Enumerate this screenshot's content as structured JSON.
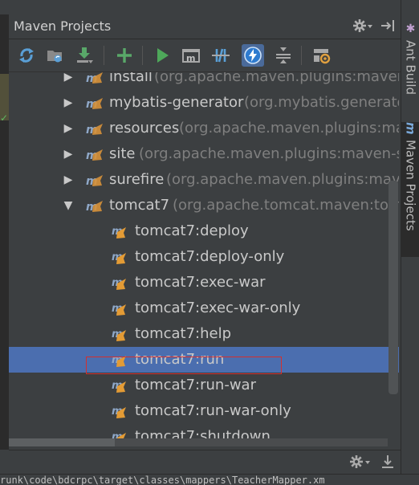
{
  "window": {
    "title": "Maven Projects"
  },
  "title_icons": [
    "gear-dropdown-icon",
    "hide-panel-icon"
  ],
  "toolbar": {
    "buttons": [
      {
        "name": "reimport-icon"
      },
      {
        "name": "generate-sources-icon"
      },
      {
        "name": "download-icon"
      },
      {
        "name": "add-icon"
      },
      {
        "name": "run-icon"
      },
      {
        "name": "execute-goal-icon"
      },
      {
        "name": "toggle-offline-icon"
      },
      {
        "name": "skip-tests-icon"
      },
      {
        "name": "collapse-all-icon"
      },
      {
        "name": "settings-icon"
      }
    ]
  },
  "tree": {
    "plugins": [
      {
        "name": "install",
        "detail": "(org.apache.maven.plugins:maven-i"
      },
      {
        "name": "mybatis-generator",
        "detail": "(org.mybatis.generator"
      },
      {
        "name": "resources",
        "detail": "(org.apache.maven.plugins:mave"
      },
      {
        "name": "site",
        "detail": "(org.apache.maven.plugins:maven-site"
      },
      {
        "name": "surefire",
        "detail": "(org.apache.maven.plugins:maven"
      },
      {
        "name": "tomcat7",
        "detail": "(org.apache.tomcat.maven:tomca"
      }
    ],
    "goals": [
      "tomcat7:deploy",
      "tomcat7:deploy-only",
      "tomcat7:exec-war",
      "tomcat7:exec-war-only",
      "tomcat7:help",
      "tomcat7:run",
      "tomcat7:run-war",
      "tomcat7:run-war-only",
      "tomcat7:shutdown"
    ],
    "selected_goal": "tomcat7:run"
  },
  "right_tabs": [
    {
      "label": "Ant Build",
      "icon": "ant-icon"
    },
    {
      "label": "Maven Projects",
      "icon": "maven-icon"
    }
  ],
  "status": {
    "path": "runk\\code\\bdcrpc\\target\\classes\\mappers\\TeacherMapper.xm"
  },
  "colors": {
    "selection": "#4b6eaf",
    "highlight_box": "#d4302e",
    "run_green": "#59a869",
    "plugin_detail": "#7f7f7f"
  }
}
